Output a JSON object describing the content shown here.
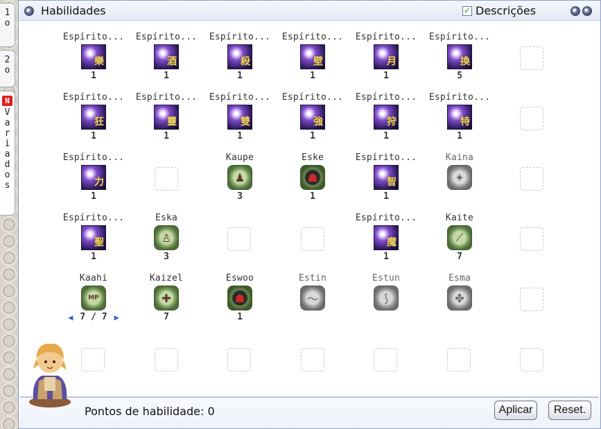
{
  "tabs": {
    "tab1": [
      "1",
      "o"
    ],
    "tab2": [
      "2",
      "o"
    ],
    "tab3_badge": "N",
    "tab3": [
      "V",
      "a",
      "r",
      "i",
      "a",
      "d",
      "o",
      "s"
    ]
  },
  "window": {
    "title": "Habilidades",
    "descriptions_label": "Descrições",
    "descriptions_checked": true
  },
  "skills": [
    {
      "name": "Espírito...",
      "level": "1",
      "kanji": "樂"
    },
    {
      "name": "Espírito...",
      "level": "1",
      "kanji": "酒"
    },
    {
      "name": "Espírito...",
      "level": "1",
      "kanji": "殺"
    },
    {
      "name": "Espírito...",
      "level": "1",
      "kanji": "壁"
    },
    {
      "name": "Espírito...",
      "level": "1",
      "kanji": "月"
    },
    {
      "name": "Espírito...",
      "level": "5",
      "kanji": "換"
    },
    {
      "name": "Espírito...",
      "level": "1",
      "kanji": "狂"
    },
    {
      "name": "Espírito...",
      "level": "1",
      "kanji": "靈"
    },
    {
      "name": "Espírito...",
      "level": "1",
      "kanji": "雙"
    },
    {
      "name": "Espírito...",
      "level": "1",
      "kanji": "強"
    },
    {
      "name": "Espírito...",
      "level": "1",
      "kanji": "狩"
    },
    {
      "name": "Espírito...",
      "level": "1",
      "kanji": "特"
    },
    {
      "name": "Espírito...",
      "level": "1",
      "kanji": "力"
    },
    {
      "name": "Kaupe",
      "level": "3"
    },
    {
      "name": "Eske",
      "level": "1"
    },
    {
      "name": "Espírito...",
      "level": "1",
      "kanji": "智"
    },
    {
      "name": "Kaina",
      "level": ""
    },
    {
      "name": "Espírito...",
      "level": "1",
      "kanji": "聖"
    },
    {
      "name": "Eska",
      "level": "3"
    },
    {
      "name": "Espírito...",
      "level": "1",
      "kanji": "魔"
    },
    {
      "name": "Kaite",
      "level": "7"
    },
    {
      "name": "Kaahi",
      "level": "7 / 7",
      "glyph": "MP"
    },
    {
      "name": "Kaizel",
      "level": "7"
    },
    {
      "name": "Eswoo",
      "level": "1"
    },
    {
      "name": "Estin",
      "level": ""
    },
    {
      "name": "Estun",
      "level": ""
    },
    {
      "name": "Esma",
      "level": ""
    }
  ],
  "footer": {
    "points_label": "Pontos de habilidade: 0",
    "apply_label": "Aplicar",
    "reset_label": "Reset."
  },
  "icons": {
    "close": "close-icon",
    "minimize": "minimize-icon",
    "window": "window-icon",
    "prev": "left-arrow-icon",
    "next": "right-arrow-icon"
  }
}
